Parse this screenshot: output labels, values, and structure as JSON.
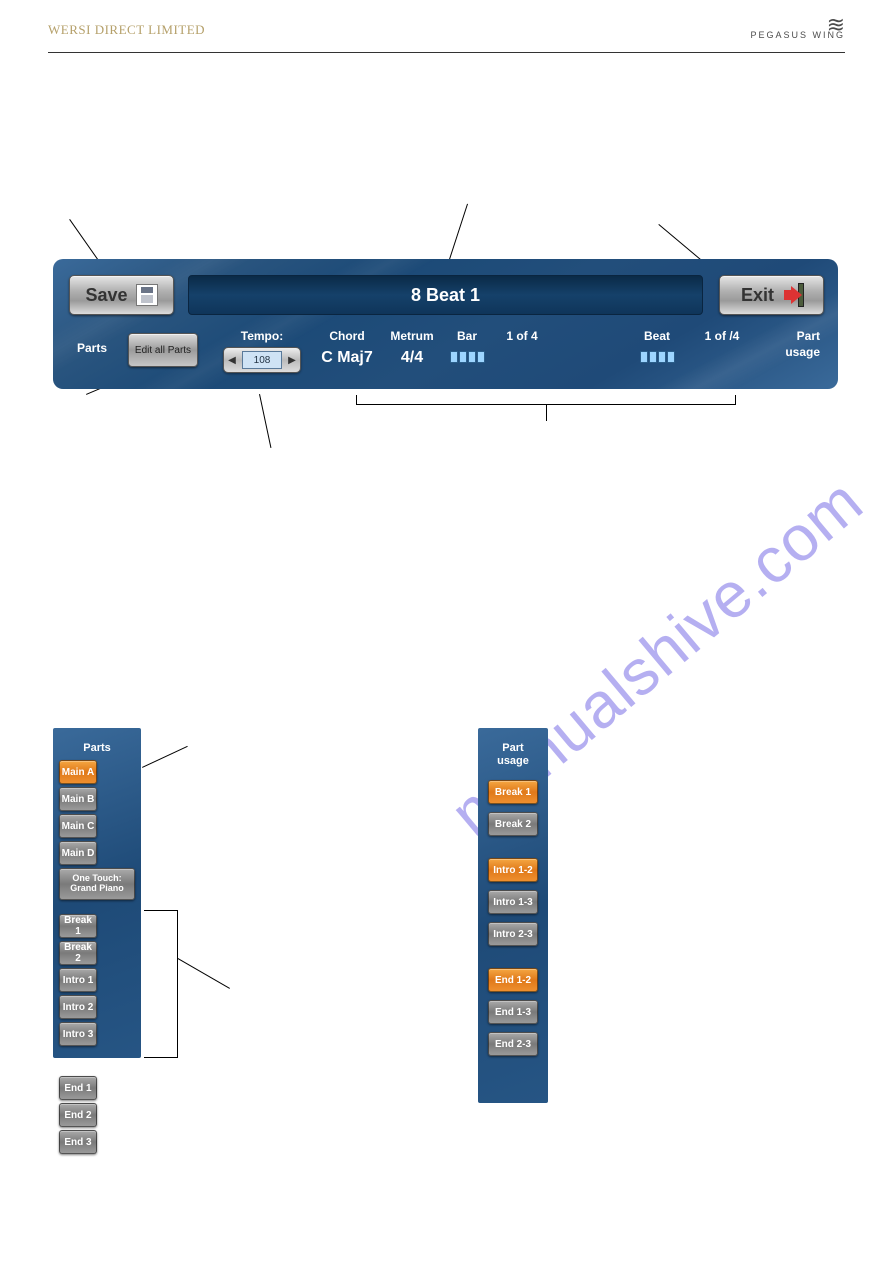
{
  "header": {
    "left_logo_text": "WERSI DIRECT LIMITED",
    "right_logo_line1": "≋",
    "right_logo_line2": "PEGASUS WING"
  },
  "watermark": "manualshive.com",
  "top_panel": {
    "save_label": "Save",
    "exit_label": "Exit",
    "title": "8 Beat 1",
    "parts_label": "Parts",
    "edit_all_label": "Edit all Parts",
    "tempo_label": "Tempo:",
    "tempo_value": "108",
    "chord_label": "Chord",
    "chord_value": "C Maj7",
    "metrum_label": "Metrum",
    "metrum_value": "4/4",
    "bar_label": "Bar",
    "bar_value": "1 of 4",
    "beat_label": "Beat",
    "beat_value": "1 of /4",
    "part_usage_label1": "Part",
    "part_usage_label2": "usage"
  },
  "parts_panel": {
    "title": "Parts",
    "mains": [
      {
        "label": "Main A",
        "state": "orange"
      },
      {
        "label": "Main B",
        "state": "grey"
      },
      {
        "label": "Main C",
        "state": "grey"
      },
      {
        "label": "Main D",
        "state": "grey"
      }
    ],
    "one_touch": "One Touch: Grand Piano",
    "seq": [
      {
        "label": "Break 1",
        "state": "grey"
      },
      {
        "label": "Break 2",
        "state": "grey"
      },
      {
        "label": "Intro 1",
        "state": "grey"
      },
      {
        "label": "Intro 2",
        "state": "grey"
      },
      {
        "label": "Intro 3",
        "state": "grey",
        "full": false
      },
      {
        "label": "End 1",
        "state": "grey"
      },
      {
        "label": "End 2",
        "state": "grey"
      },
      {
        "label": "End 3",
        "state": "grey",
        "full": false
      }
    ]
  },
  "usage_panel": {
    "title1": "Part",
    "title2": "usage",
    "rows": [
      {
        "label": "Break 1",
        "state": "orange"
      },
      {
        "label": "Break 2",
        "state": "grey"
      },
      {
        "label": "Intro 1-2",
        "state": "orange",
        "gap_before": true
      },
      {
        "label": "Intro 1-3",
        "state": "grey"
      },
      {
        "label": "Intro 2-3",
        "state": "grey"
      },
      {
        "label": "End 1-2",
        "state": "orange",
        "gap_before": true
      },
      {
        "label": "End 1-3",
        "state": "grey"
      },
      {
        "label": "End 2-3",
        "state": "grey"
      }
    ]
  }
}
